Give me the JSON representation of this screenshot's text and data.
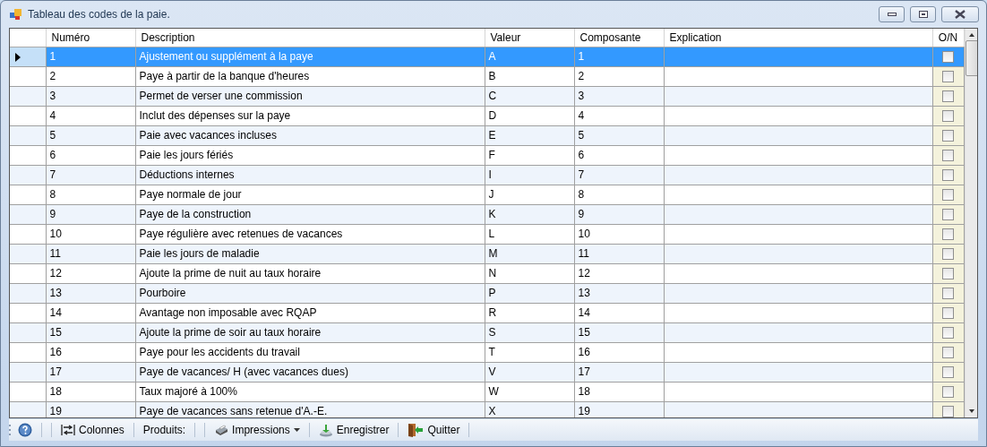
{
  "window": {
    "title": "Tableau des codes de la paie."
  },
  "table": {
    "columns": [
      "Numéro",
      "Description",
      "Valeur",
      "Composante",
      "Explication",
      "O/N"
    ],
    "rows": [
      {
        "numero": "1",
        "description": "Ajustement ou supplément à la paye",
        "valeur": "A",
        "composante": "1",
        "checked": false,
        "selected": true
      },
      {
        "numero": "2",
        "description": "Paye à partir de la banque d'heures",
        "valeur": "B",
        "composante": "2",
        "checked": false,
        "selected": false
      },
      {
        "numero": "3",
        "description": "Permet de verser une commission",
        "valeur": "C",
        "composante": "3",
        "checked": false,
        "selected": false
      },
      {
        "numero": "4",
        "description": "Inclut des dépenses sur la paye",
        "valeur": "D",
        "composante": "4",
        "checked": false,
        "selected": false
      },
      {
        "numero": "5",
        "description": "Paie avec vacances incluses",
        "valeur": "E",
        "composante": "5",
        "checked": false,
        "selected": false
      },
      {
        "numero": "6",
        "description": "Paie les jours fériés",
        "valeur": "F",
        "composante": "6",
        "checked": false,
        "selected": false
      },
      {
        "numero": "7",
        "description": "Déductions internes",
        "valeur": "I",
        "composante": "7",
        "checked": false,
        "selected": false
      },
      {
        "numero": "8",
        "description": "Paye normale de jour",
        "valeur": "J",
        "composante": "8",
        "checked": false,
        "selected": false
      },
      {
        "numero": "9",
        "description": "Paye de la construction",
        "valeur": "K",
        "composante": "9",
        "checked": false,
        "selected": false
      },
      {
        "numero": "10",
        "description": "Paye régulière avec retenues de vacances",
        "valeur": "L",
        "composante": "10",
        "checked": false,
        "selected": false
      },
      {
        "numero": "11",
        "description": "Paie les jours de maladie",
        "valeur": "M",
        "composante": "11",
        "checked": false,
        "selected": false
      },
      {
        "numero": "12",
        "description": "Ajoute la prime de nuit au taux horaire",
        "valeur": "N",
        "composante": "12",
        "checked": false,
        "selected": false
      },
      {
        "numero": "13",
        "description": "Pourboire",
        "valeur": "P",
        "composante": "13",
        "checked": false,
        "selected": false
      },
      {
        "numero": "14",
        "description": "Avantage non imposable avec RQAP",
        "valeur": "R",
        "composante": "14",
        "checked": false,
        "selected": false
      },
      {
        "numero": "15",
        "description": "Ajoute la prime de soir au taux horaire",
        "valeur": "S",
        "composante": "15",
        "checked": false,
        "selected": false
      },
      {
        "numero": "16",
        "description": "Paye pour les accidents du travail",
        "valeur": "T",
        "composante": "16",
        "checked": false,
        "selected": false
      },
      {
        "numero": "17",
        "description": "Paye de vacances/ H (avec vacances dues)",
        "valeur": "V",
        "composante": "17",
        "checked": false,
        "selected": false
      },
      {
        "numero": "18",
        "description": "Taux majoré à 100%",
        "valeur": "W",
        "composante": "18",
        "checked": false,
        "selected": false
      },
      {
        "numero": "19",
        "description": "Paye de vacances sans retenue d'A.-E.",
        "valeur": "X",
        "composante": "19",
        "checked": false,
        "selected": false
      }
    ]
  },
  "toolbar": [
    {
      "kind": "help"
    },
    {
      "kind": "button",
      "label": "Colonnes"
    },
    {
      "kind": "label",
      "label": "Produits:"
    },
    {
      "kind": "dropdown",
      "label": "Impressions"
    },
    {
      "kind": "button",
      "label": "Enregistrer"
    },
    {
      "kind": "button",
      "label": "Quitter"
    }
  ]
}
